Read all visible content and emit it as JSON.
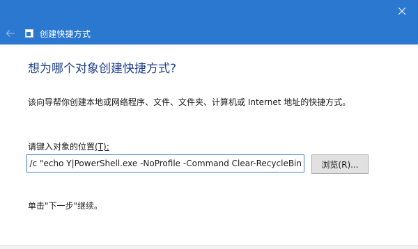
{
  "window": {
    "title": "创建快捷方式",
    "titlebar_color": "#2b78d0"
  },
  "wizard": {
    "heading": "想为哪个对象创建快捷方式?",
    "description": "该向导帮你创建本地或网络程序、文件、文件夹、计算机或 Internet 地址的快捷方式。",
    "location_label": "请键入对象的位置",
    "location_label_hotkey": "(T):",
    "location_value": "cmd.exe /c \"echo Y|PowerShell.exe -NoProfile -Command Clear-RecycleBin\"",
    "browse_label": "浏览(R)...",
    "hint": "单击\"下一步\"继续。"
  },
  "icons": {
    "back": "back-arrow-icon",
    "app": "shortcut-app-icon",
    "close": "close-icon"
  }
}
